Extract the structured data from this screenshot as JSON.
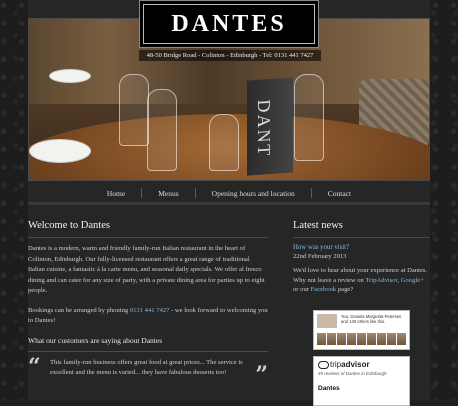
{
  "brand": {
    "name": "DANTES",
    "address": "48-50 Bridge Road - Colinton - Edinburgh - Tel: 0131 441 7427"
  },
  "hero": {
    "menu_card_text": "DANT"
  },
  "nav": {
    "items": [
      {
        "label": "Home"
      },
      {
        "label": "Menus"
      },
      {
        "label": "Opening hours and location"
      },
      {
        "label": "Contact"
      }
    ]
  },
  "main": {
    "title": "Welcome to Dantes",
    "intro": "Dantes is a modern, warm and friendly family-run Italian restaurant in the heart of Colinton, Edinburgh. Our fully-licensed restaurant offers a great range of traditional Italian cuisine, a fantastic à la carte menu, and seasonal daily specials. We offer al fresco dining and can cater for any size of party, with a private dining area for parties up to eight people.",
    "booking_prefix": "Bookings can be arranged by phoning ",
    "booking_phone": "0131 441 7427",
    "booking_suffix": " - we look forward to welcoming you to Dantes!",
    "testimonials_title": "What our customers are saying about Dantes",
    "quote": "This family-run business offers great food at great prices... The service is excellent and the menu is varied... they have fabulous desserts too!"
  },
  "sidebar": {
    "title": "Latest news",
    "news_link": "How was your visit?",
    "news_date": "22nd February 2013",
    "news_text_1": "We'd love to hear about your experience at Dantes. Why not leave a review on ",
    "tripadvisor_link": "TripAdvisor",
    "news_text_2": ", ",
    "google_link": "Google+",
    "news_text_3": " or our ",
    "facebook_link": "Facebook",
    "news_text_4": " page?",
    "fb_widget_text": "You, Daniela Margiotta-Petersen and 140 others like this.",
    "ta_logo_trip": "trip",
    "ta_logo_advisor": "advisor",
    "ta_reviews": "45 reviews of Dantes in Edinburgh",
    "ta_name": "Dantes"
  }
}
